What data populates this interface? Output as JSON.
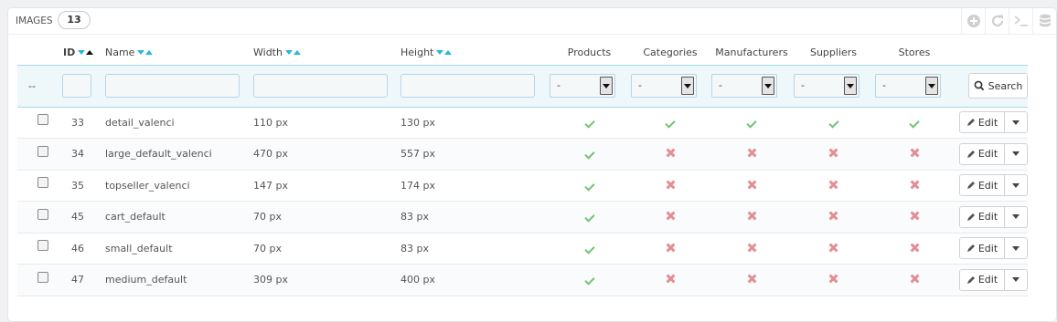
{
  "panel": {
    "title": "Images",
    "count": "13"
  },
  "toolbar": [
    {
      "name": "add-new-icon"
    },
    {
      "name": "refresh-icon"
    },
    {
      "name": "sql-query-icon"
    },
    {
      "name": "export-database-icon"
    }
  ],
  "columns": {
    "id": "ID",
    "name": "Name",
    "width": "Width",
    "height": "Height",
    "products": "Products",
    "categories": "Categories",
    "manufacturers": "Manufacturers",
    "suppliers": "Suppliers",
    "stores": "Stores"
  },
  "filter": {
    "reset_label": "--",
    "select_value": "-",
    "search_label": "Search"
  },
  "edit_label": "Edit",
  "rows": [
    {
      "id": "33",
      "name": "detail_valenci",
      "width": "110 px",
      "height": "130 px",
      "products": true,
      "categories": true,
      "manufacturers": true,
      "suppliers": true,
      "stores": true
    },
    {
      "id": "34",
      "name": "large_default_valenci",
      "width": "470 px",
      "height": "557 px",
      "products": true,
      "categories": false,
      "manufacturers": false,
      "suppliers": false,
      "stores": false
    },
    {
      "id": "35",
      "name": "topseller_valenci",
      "width": "147 px",
      "height": "174 px",
      "products": true,
      "categories": false,
      "manufacturers": false,
      "suppliers": false,
      "stores": false
    },
    {
      "id": "45",
      "name": "cart_default",
      "width": "70 px",
      "height": "83 px",
      "products": true,
      "categories": false,
      "manufacturers": false,
      "suppliers": false,
      "stores": false
    },
    {
      "id": "46",
      "name": "small_default",
      "width": "70 px",
      "height": "83 px",
      "products": true,
      "categories": false,
      "manufacturers": false,
      "suppliers": false,
      "stores": false
    },
    {
      "id": "47",
      "name": "medium_default",
      "width": "309 px",
      "height": "400 px",
      "products": true,
      "categories": false,
      "manufacturers": false,
      "suppliers": false,
      "stores": false
    }
  ]
}
